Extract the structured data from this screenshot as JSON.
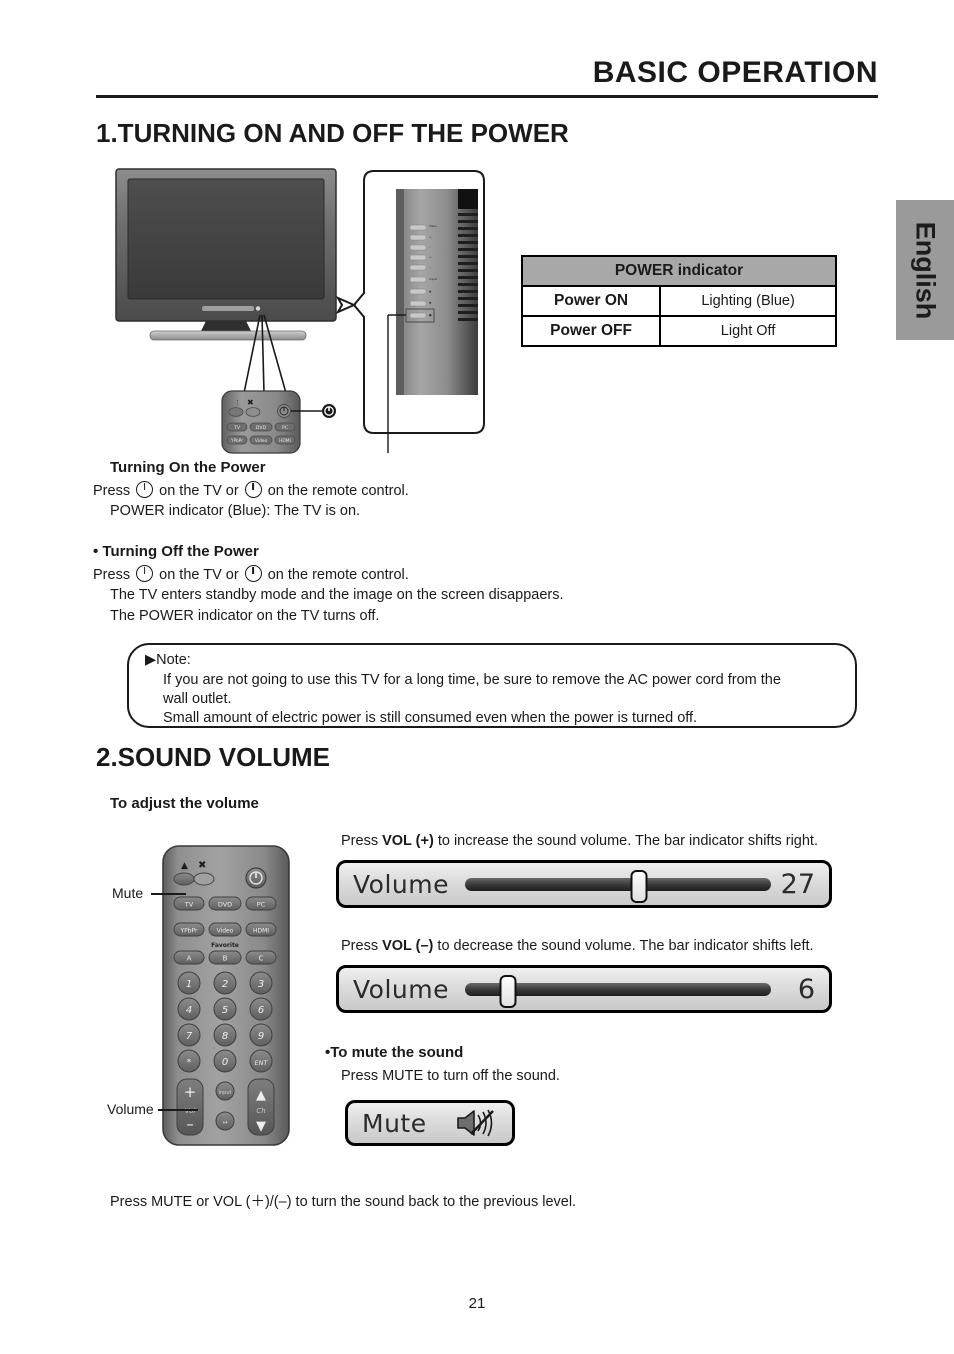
{
  "header": {
    "title": "BASIC OPERATION"
  },
  "side_tab": {
    "label": "English"
  },
  "sections": {
    "section1_heading": "1.TURNING ON AND OFF THE POWER",
    "section2_heading": "2.SOUND VOLUME"
  },
  "illustration": {
    "power_button_label": "Power Button",
    "tv_front_name": "tv-front",
    "tv_side_name": "tv-side-panel",
    "remote_name": "remote-control"
  },
  "power_table": {
    "header": "POWER indicator",
    "rows": [
      {
        "label": "Power ON",
        "value": "Lighting (Blue)"
      },
      {
        "label": "Power OFF",
        "value": "Light Off"
      }
    ]
  },
  "turning_on": {
    "heading": "Turning On the Power",
    "press_prefix": "Press",
    "press_mid": "on the TV or",
    "press_suffix": "on the remote control.",
    "detail": "POWER indicator (Blue): The TV is on."
  },
  "turning_off": {
    "heading": "• Turning Off the Power",
    "press_prefix": "Press",
    "press_mid": "on the TV or",
    "press_suffix": "on the remote control.",
    "detail1": "The TV enters standby mode and the image on the screen disappaers.",
    "detail2": "The POWER indicator on the TV turns off."
  },
  "note": {
    "label": "▶Note:",
    "line1": "If you are not going to use this TV for a long time, be sure to remove the AC power cord from the",
    "line2": "wall outlet.",
    "line3": "Small amount of electric power is still consumed even when the power is turned off."
  },
  "volume": {
    "adjust_heading": "To adjust the volume",
    "up_caption_pre": "Press ",
    "up_caption_bold": "VOL (+)",
    "up_caption_post": " to increase the sound volume. The bar indicator shifts right.",
    "down_caption_pre": "Press ",
    "down_caption_bold": "VOL (–)",
    "down_caption_post": " to decrease the sound volume. The bar indicator shifts left.",
    "osd_label": "Volume",
    "value_up": "27",
    "value_down": "6",
    "knob_up_percent": 57,
    "knob_down_percent": 14
  },
  "mute": {
    "heading": "•To mute the sound",
    "caption": "Press MUTE to turn off the sound.",
    "osd_label": "Mute"
  },
  "callouts": {
    "mute": "Mute",
    "volume": "Volume"
  },
  "closing": "Press MUTE or VOL (＋)/(–) to turn the sound back to the previous level.",
  "footer": {
    "page_number": "21"
  },
  "remote_buttons": {
    "source_row1": [
      "TV",
      "DVD",
      "PC"
    ],
    "source_row2": [
      "YPbPr",
      "Video",
      "HDMI"
    ],
    "favorite_label": "Favorite",
    "favorite_row": [
      "A",
      "B",
      "C"
    ],
    "numbers": [
      "1",
      "2",
      "3",
      "4",
      "5",
      "6",
      "7",
      "8",
      "9",
      "*",
      "0",
      "ENT"
    ],
    "vol_label": "Vol",
    "ch_label": "Ch",
    "plus": "+",
    "minus": "–"
  },
  "colors": {
    "tab_gray": "#9a9a9a",
    "table_header_gray": "#a8a8a8",
    "ink": "#1a1a1a"
  }
}
